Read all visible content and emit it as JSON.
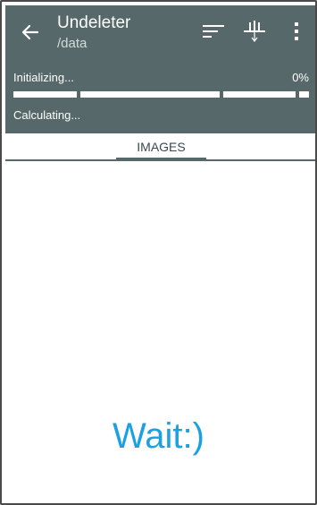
{
  "app_bar": {
    "title": "Undeleter",
    "subtitle": "/data",
    "back_icon": "arrow-back-icon",
    "actions": [
      "sort-icon",
      "filter-icon",
      "more-vert-icon"
    ]
  },
  "progress": {
    "status": "Initializing...",
    "percent_label": "0%",
    "percent": 0,
    "secondary_status": "Calculating..."
  },
  "tabs": [
    {
      "label": "IMAGES",
      "selected": true
    }
  ],
  "content": {
    "message": "Wait:)"
  },
  "colors": {
    "header": "#566869",
    "accent_text": "#1ba1e2"
  }
}
